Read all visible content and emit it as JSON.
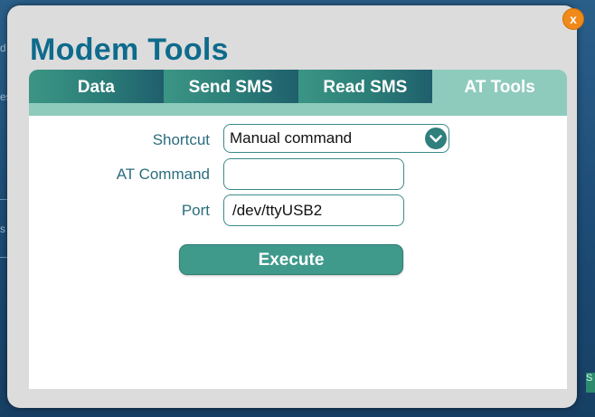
{
  "background": {
    "side_texts": [
      "d",
      "es",
      "s"
    ],
    "right_text": "S"
  },
  "modal": {
    "title": "Modem Tools",
    "close_label": "x"
  },
  "tabs": [
    {
      "label": "Data",
      "active": false
    },
    {
      "label": "Send SMS",
      "active": false
    },
    {
      "label": "Read SMS",
      "active": false
    },
    {
      "label": "AT Tools",
      "active": true
    }
  ],
  "form": {
    "shortcut": {
      "label": "Shortcut",
      "selected": "Manual command"
    },
    "at_command": {
      "label": "AT Command",
      "value": ""
    },
    "port": {
      "label": "Port",
      "value": "/dev/ttyUSB2"
    },
    "execute_label": "Execute"
  },
  "colors": {
    "title": "#0e6b8c",
    "tab_gradient_start": "#3b9584",
    "tab_active": "#8fcbbd",
    "label": "#2b6d7d",
    "button": "#3f9a8c",
    "close_button": "#f08a1a"
  },
  "icons": {
    "close": "close-icon",
    "select": "chevron-down-icon"
  }
}
